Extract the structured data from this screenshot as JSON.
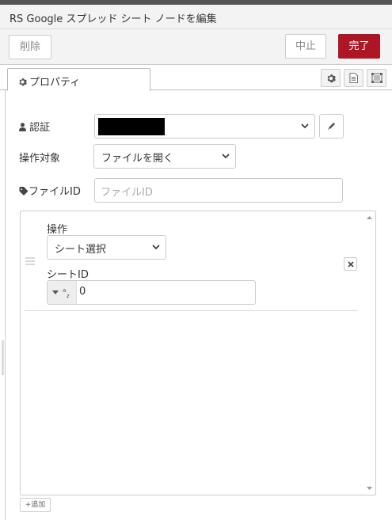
{
  "window": {
    "title": "RS Google スプレッド シート ノードを編集"
  },
  "toolbar": {
    "delete_label": "削除",
    "cancel_label": "中止",
    "done_label": "完了"
  },
  "tabs": {
    "properties_label": "プロパティ",
    "icons": [
      "gear-icon",
      "description-icon",
      "appearance-icon"
    ]
  },
  "form": {
    "auth": {
      "label": "認証",
      "value": "",
      "redacted": true,
      "icon": "user-icon"
    },
    "operation_target": {
      "label": "操作対象",
      "value": "ファイルを開く"
    },
    "file_id": {
      "label": "ファイルID",
      "value": "",
      "placeholder": "ファイルID",
      "icon": "tag-icon"
    }
  },
  "operations_list": {
    "rows": [
      {
        "operation_label": "操作",
        "operation_value": "シート選択",
        "sheet_id_label": "シートID",
        "sheet_id_type": "az",
        "sheet_id_value": "0"
      }
    ],
    "add_label": "+追加"
  },
  "colors": {
    "accent": "#ad1625",
    "border": "#cccccc",
    "background": "#f3f3f3"
  }
}
